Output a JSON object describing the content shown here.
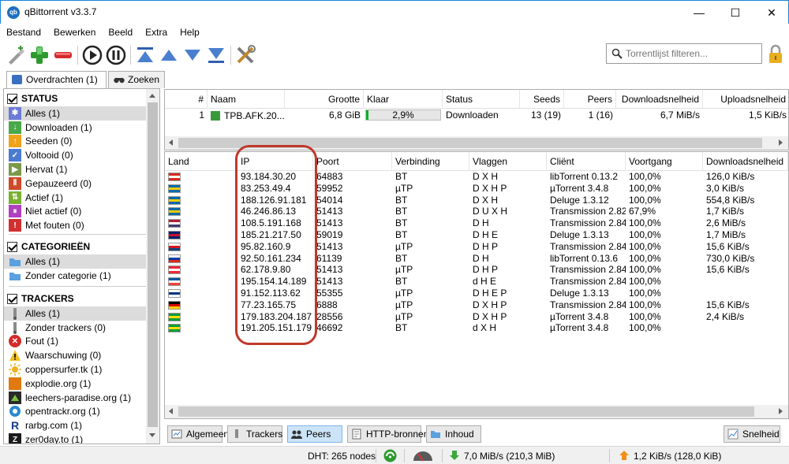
{
  "window": {
    "title": "qBittorrent v3.3.7",
    "app_icon": "qb",
    "min": "—",
    "max": "☐",
    "close": "✕"
  },
  "menu": [
    "Bestand",
    "Bewerken",
    "Beeld",
    "Extra",
    "Help"
  ],
  "toolbar": {
    "filter_placeholder": "Torrentlijst filteren...",
    "icons": [
      "add-link-icon",
      "add-torrent-icon",
      "remove-icon",
      "resume-icon",
      "pause-icon",
      "move-top-icon",
      "move-up-icon",
      "move-down-icon",
      "move-bottom-icon",
      "options-icon"
    ]
  },
  "tabs": [
    {
      "label": "Overdrachten (1)"
    },
    {
      "label": "Zoeken"
    }
  ],
  "sidebar": {
    "status_header": "STATUS",
    "status_items": [
      {
        "label": "Alles (1)",
        "color": "#6c7bd6"
      },
      {
        "label": "Downloaden (1)",
        "color": "#4aa84a"
      },
      {
        "label": "Seeden (0)",
        "color": "#f0a21a"
      },
      {
        "label": "Voltooid (0)",
        "color": "#4a7bd0"
      },
      {
        "label": "Hervat (1)",
        "color": "#7a9a4a"
      },
      {
        "label": "Gepauzeerd (0)",
        "color": "#d04a2a"
      },
      {
        "label": "Actief (1)",
        "color": "#7ab030"
      },
      {
        "label": "Niet actief (0)",
        "color": "#b040c0"
      },
      {
        "label": "Met fouten (0)",
        "color": "#d03030"
      }
    ],
    "categories_header": "CATEGORIEËN",
    "category_items": [
      {
        "label": "Alles (1)"
      },
      {
        "label": "Zonder categorie (1)"
      }
    ],
    "trackers_header": "TRACKERS",
    "tracker_items": [
      {
        "label": "Alles (1)"
      },
      {
        "label": "Zonder trackers (0)"
      },
      {
        "label": "Fout (1)"
      },
      {
        "label": "Waarschuwing (0)"
      },
      {
        "label": "coppersurfer.tk (1)"
      },
      {
        "label": "explodie.org (1)"
      },
      {
        "label": "leechers-paradise.org (1)"
      },
      {
        "label": "opentrackr.org (1)"
      },
      {
        "label": "rarbg.com (1)"
      },
      {
        "label": "zer0day.to (1)"
      }
    ]
  },
  "torrents": {
    "headers": [
      "#",
      "Naam",
      "Grootte",
      "Klaar",
      "Status",
      "Seeds",
      "Peers",
      "Downloadsnelheid",
      "Uploadsnelheid"
    ],
    "rows": [
      {
        "num": "1",
        "name": "TPB.AFK.20...",
        "size": "6,8 GiB",
        "progress_text": "2,9%",
        "progress": 0.029,
        "status": "Downloaden",
        "seeds": "13 (19)",
        "peers": "1 (16)",
        "down": "6,7 MiB/s",
        "up": "1,5 KiB/s"
      }
    ]
  },
  "peers": {
    "headers": [
      "Land",
      "IP",
      "Poort",
      "Verbinding",
      "Vlaggen",
      "Cliënt",
      "Voortgang",
      "Downloadsnelheid"
    ],
    "rows": [
      {
        "flag": [
          "#d52b1e",
          "#ffffff",
          "#d52b1e"
        ],
        "ip": "93.184.30.20",
        "port": "64883",
        "conn": "BT",
        "flags": "D X H",
        "client": "libTorrent 0.13.2",
        "progress": "100,0%",
        "down": "126,0 KiB/s"
      },
      {
        "flag": [
          "#006aa7",
          "#fecc00",
          "#006aa7"
        ],
        "ip": "83.253.49.4",
        "port": "59952",
        "conn": "µTP",
        "flags": "D X H P",
        "client": "µTorrent 3.4.8",
        "progress": "100,0%",
        "down": "3,0 KiB/s"
      },
      {
        "flag": [
          "#006aa7",
          "#fecc00",
          "#006aa7"
        ],
        "ip": "188.126.91.181",
        "port": "54014",
        "conn": "BT",
        "flags": "D X H",
        "client": "Deluge 1.3.12",
        "progress": "100,0%",
        "down": "554,8 KiB/s"
      },
      {
        "flag": [
          "#006aa7",
          "#fecc00",
          "#006aa7"
        ],
        "ip": "46.246.86.13",
        "port": "51413",
        "conn": "BT",
        "flags": "D U X H",
        "client": "Transmission 2.82",
        "progress": "67,9%",
        "down": "1,7 KiB/s"
      },
      {
        "flag": [
          "#b22234",
          "#ffffff",
          "#3c3b6e"
        ],
        "ip": "108.5.191.168",
        "port": "51413",
        "conn": "BT",
        "flags": "D H",
        "client": "Transmission 2.84",
        "progress": "100,0%",
        "down": "2,6 MiB/s"
      },
      {
        "flag": [
          "#012169",
          "#c8102e",
          "#012169"
        ],
        "ip": "185.21.217.50",
        "port": "59019",
        "conn": "BT",
        "flags": "D H E",
        "client": "Deluge 1.3.13",
        "progress": "100,0%",
        "down": "1,7 MiB/s"
      },
      {
        "flag": [
          "#ffffff",
          "#d7141a",
          "#11457e"
        ],
        "ip": "95.82.160.9",
        "port": "51413",
        "conn": "µTP",
        "flags": "D H P",
        "client": "Transmission 2.84",
        "progress": "100,0%",
        "down": "15,6 KiB/s"
      },
      {
        "flag": [
          "#ffffff",
          "#0039a6",
          "#d52b1e"
        ],
        "ip": "92.50.161.234",
        "port": "61139",
        "conn": "BT",
        "flags": "D H",
        "client": "libTorrent 0.13.6",
        "progress": "100,0%",
        "down": "730,0 KiB/s"
      },
      {
        "flag": [
          "#ed2939",
          "#ffffff",
          "#ed2939"
        ],
        "ip": "62.178.9.80",
        "port": "51413",
        "conn": "µTP",
        "flags": "D H P",
        "client": "Transmission 2.84",
        "progress": "100,0%",
        "down": "15,6 KiB/s"
      },
      {
        "flag": [
          "#0055a4",
          "#ffffff",
          "#ef4135"
        ],
        "ip": "195.154.14.189",
        "port": "51413",
        "conn": "BT",
        "flags": "d H E",
        "client": "Transmission 2.84",
        "progress": "100,0%",
        "down": ""
      },
      {
        "flag": [
          "#ffffff",
          "#003580",
          "#ffffff"
        ],
        "ip": "91.152.113.62",
        "port": "55355",
        "conn": "µTP",
        "flags": "D H E P",
        "client": "Deluge 1.3.13",
        "progress": "100,0%",
        "down": ""
      },
      {
        "flag": [
          "#000000",
          "#dd0000",
          "#ffce00"
        ],
        "ip": "77.23.165.75",
        "port": "6888",
        "conn": "µTP",
        "flags": "D X H P",
        "client": "Transmission 2.84",
        "progress": "100,0%",
        "down": "15,6 KiB/s"
      },
      {
        "flag": [
          "#009c3b",
          "#ffdf00",
          "#009c3b"
        ],
        "ip": "179.183.204.187",
        "port": "28556",
        "conn": "µTP",
        "flags": "D X H P",
        "client": "µTorrent 3.4.8",
        "progress": "100,0%",
        "down": "2,4 KiB/s"
      },
      {
        "flag": [
          "#009c3b",
          "#ffdf00",
          "#009c3b"
        ],
        "ip": "191.205.151.179",
        "port": "46692",
        "conn": "BT",
        "flags": "d X H",
        "client": "µTorrent 3.4.8",
        "progress": "100,0%",
        "down": ""
      }
    ]
  },
  "bottom_tabs": {
    "general": "Algemeen",
    "trackers": "Trackers",
    "peers": "Peers",
    "http": "HTTP-bronnen",
    "content": "Inhoud",
    "speed": "Snelheid"
  },
  "statusbar": {
    "dht": "DHT: 265 nodes",
    "down": "7,0 MiB/s (210,3 MiB)",
    "up": "1,2 KiB/s (128,0 KiB)"
  },
  "colors": {
    "accent": "#1883d7",
    "selection": "#dcdcdc",
    "highlight_ring": "#c0392b"
  }
}
